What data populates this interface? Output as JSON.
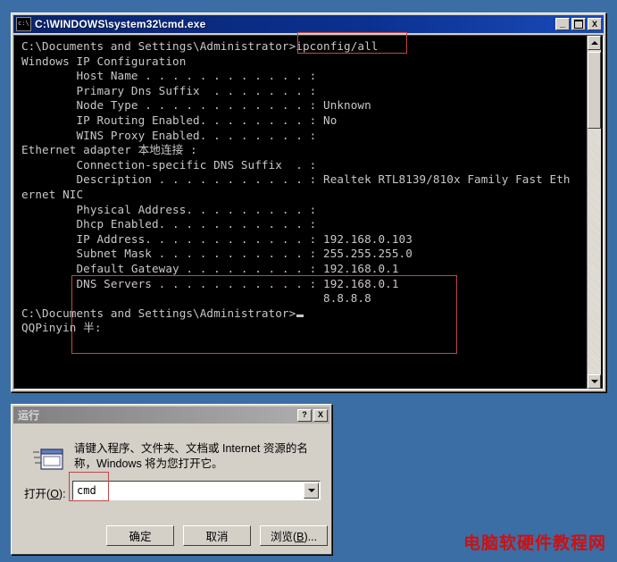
{
  "desktop": {
    "background_color": "#3b6ea5"
  },
  "cmd_window": {
    "title": "C:\\WINDOWS\\system32\\cmd.exe",
    "icon": "cmd-console-icon",
    "controls": {
      "minimize": "_",
      "maximize": "□",
      "close": "X"
    },
    "scrollbar": {
      "up_arrow": "▲",
      "down_arrow": "▼"
    },
    "console_lines": [
      "C:\\Documents and Settings\\Administrator>ipconfig/all",
      "",
      "Windows IP Configuration",
      "",
      "        Host Name . . . . . . . . . . . . :",
      "        Primary Dns Suffix  . . . . . . . :",
      "        Node Type . . . . . . . . . . . . : Unknown",
      "        IP Routing Enabled. . . . . . . . : No",
      "        WINS Proxy Enabled. . . . . . . . :",
      "",
      "Ethernet adapter 本地连接 :",
      "",
      "        Connection-specific DNS Suffix  . :",
      "        Description . . . . . . . . . . . : Realtek RTL8139/810x Family Fast Eth",
      "ernet NIC",
      "        Physical Address. . . . . . . . . :",
      "        Dhcp Enabled. . . . . . . . . . . :",
      "        IP Address. . . . . . . . . . . . : 192.168.0.103",
      "        Subnet Mask . . . . . . . . . . . : 255.255.255.0",
      "        Default Gateway . . . . . . . . . : 192.168.0.1",
      "        DNS Servers . . . . . . . . . . . : 192.168.0.1",
      "                                            8.8.8.8",
      "",
      "C:\\Documents and Settings\\Administrator>",
      "QQPinyin 半:"
    ],
    "network_values": {
      "host_name": "",
      "primary_dns_suffix": "",
      "node_type": "Unknown",
      "ip_routing_enabled": "No",
      "wins_proxy_enabled": "",
      "adapter_name": "Ethernet adapter 本地连接",
      "connection_specific_dns_suffix": "",
      "description": "Realtek RTL8139/810x Family Fast Ethernet NIC",
      "physical_address": "",
      "dhcp_enabled": "",
      "ip_address": "192.168.0.103",
      "subnet_mask": "255.255.255.0",
      "default_gateway": "192.168.0.1",
      "dns_server_1": "192.168.0.1",
      "dns_server_2": "8.8.8.8"
    },
    "command": "ipconfig/all",
    "prompt": "C:\\Documents and Settings\\Administrator>",
    "ime_status": "QQPinyin 半:"
  },
  "annotations": {
    "color": "#c04848",
    "boxes": [
      {
        "name": "command-highlight",
        "target": "ipconfig/all"
      },
      {
        "name": "ip-settings-highlight",
        "target": "IP Address / Subnet Mask / Default Gateway / DNS Servers"
      },
      {
        "name": "run-input-highlight",
        "target": "cmd"
      }
    ]
  },
  "run_dialog": {
    "title": "运行",
    "icon": "run-window-icon",
    "help_button": "?",
    "close_button": "X",
    "prompt": "请键入程序、文件夹、文档或 Internet 资源的名称，Windows 将为您打开它。",
    "open_label_prefix": "打开",
    "open_label_accel": "O",
    "open_label_suffix": ":",
    "input_value": "cmd",
    "input_placeholder": "",
    "dropdown_arrow": "▼",
    "buttons": {
      "ok": "确定",
      "cancel": "取消",
      "browse_prefix": "浏览",
      "browse_accel": "B",
      "browse_suffix": ")..."
    }
  },
  "watermark": {
    "text": "电脑软硬件教程网",
    "color": "#cc1111"
  }
}
